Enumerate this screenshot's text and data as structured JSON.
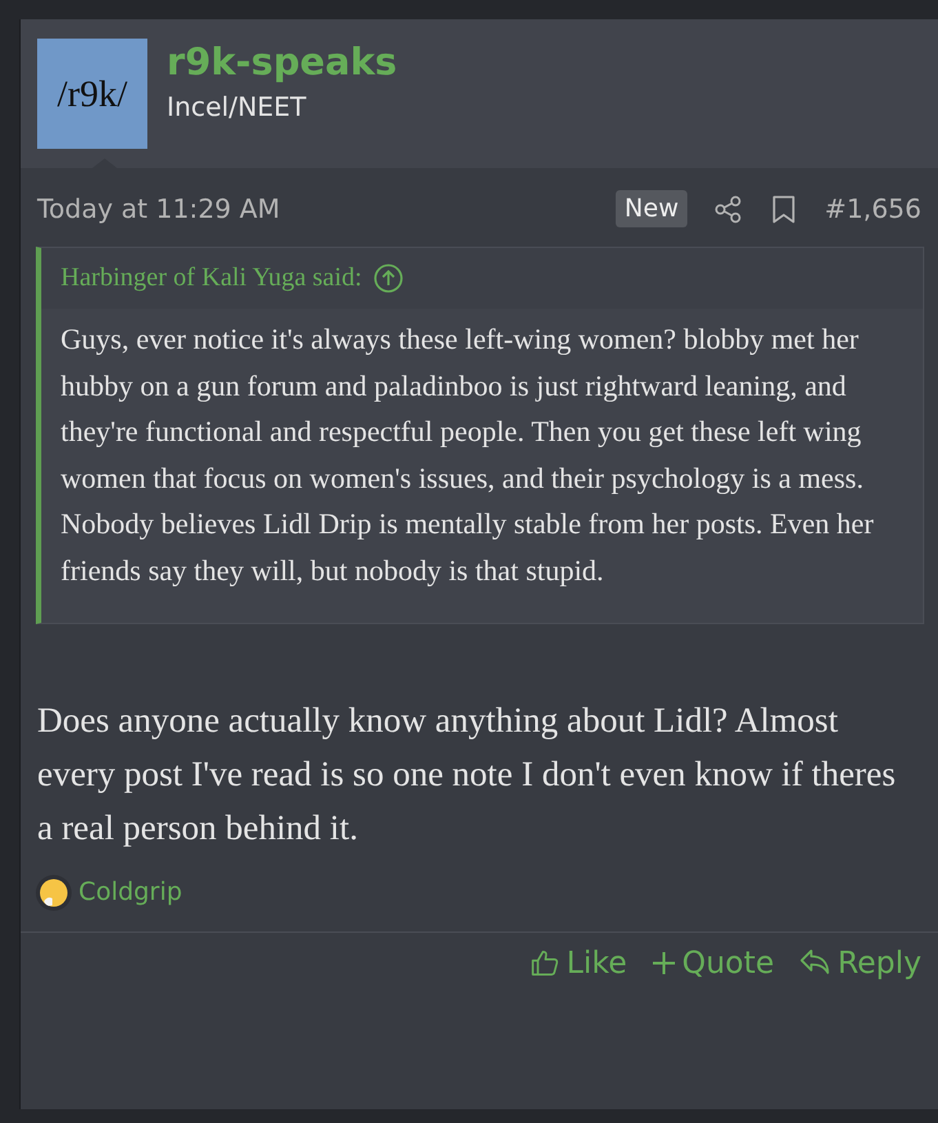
{
  "author": {
    "avatar_text": "/r9k/",
    "name": "r9k-speaks",
    "title": "Incel/NEET"
  },
  "post": {
    "date": "Today at 11:29 AM",
    "badge": "New",
    "number": "#1,656",
    "quote": {
      "attribution": "Harbinger of Kali Yuga said:",
      "text": "Guys, ever notice it's always these left-wing women? blobby met her hubby on a gun forum and paladinboo is just rightward leaning, and they're functional and respectful people. Then you get these left wing women that focus on women's issues, and their psychology is a mess. Nobody believes Lidl Drip is mentally stable from her posts. Even her friends say they will, but nobody is that stupid."
    },
    "body": "Does anyone actually know anything about Lidl? Almost every post I've read is so one note I don't even know if theres a real person behind it.",
    "reaction_users": "Coldgrip",
    "actions": [
      {
        "kind": "like",
        "label": "Like"
      },
      {
        "kind": "quote",
        "label": "Quote"
      },
      {
        "kind": "reply",
        "label": "Reply"
      }
    ]
  }
}
